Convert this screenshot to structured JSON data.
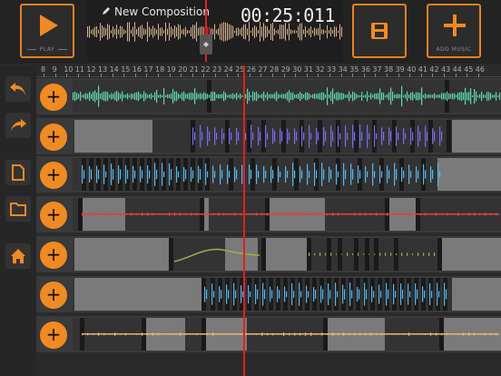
{
  "transport": {
    "play_label": "PLAY"
  },
  "composition": {
    "title": "New Composition",
    "time": "00:25:011"
  },
  "toolbar": {
    "save_icon": "floppy-disk-icon",
    "add_music_label": "ADD MUSIC"
  },
  "sidebar": {
    "items": [
      "undo-icon",
      "redo-icon",
      "new-file-icon",
      "open-folder-icon",
      "home-icon"
    ]
  },
  "ruler": {
    "ticks": [
      "8",
      "9",
      "10",
      "11",
      "12",
      "13",
      "14",
      "15",
      "16",
      "17",
      "18",
      "19",
      "20",
      "21",
      "22",
      "23",
      "24",
      "25",
      "26",
      "27",
      "28",
      "29",
      "30",
      "31",
      "32",
      "33",
      "34",
      "35",
      "36",
      "37",
      "38",
      "39",
      "40",
      "41",
      "42",
      "43",
      "44",
      "45",
      "46"
    ]
  },
  "tracks": [
    {
      "add_label": "+",
      "color": "#5fd9b0"
    },
    {
      "add_label": "+",
      "color": "#7a6cf0"
    },
    {
      "add_label": "+",
      "color": "#5ab8f0"
    },
    {
      "add_label": "+",
      "color": "#e04040"
    },
    {
      "add_label": "+",
      "color": "#9ab24a"
    },
    {
      "add_label": "+",
      "color": "#5ab8f0"
    },
    {
      "add_label": "+",
      "color": "#f0b070"
    }
  ],
  "colors": {
    "accent": "#f08a23",
    "playhead": "#e02020",
    "background": "#2a2a2a"
  }
}
